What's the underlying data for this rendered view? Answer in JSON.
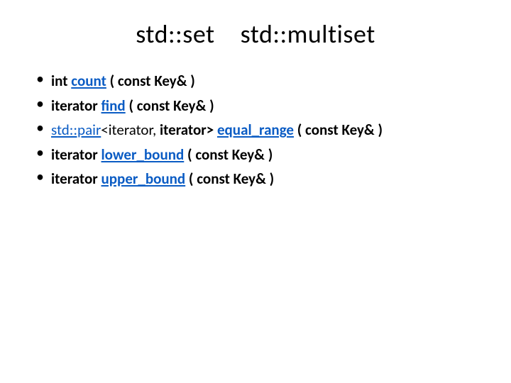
{
  "title": {
    "left": "std::set",
    "right": "std::multiset"
  },
  "items": [
    {
      "pre": "int ",
      "link": "count",
      "post": " ( const Key&  )"
    },
    {
      "pre": "iterator ",
      "link": "find",
      "post": " ( const Key& )"
    },
    {
      "pairlink": "std::pair",
      "template_open": "<iterator",
      "comma": ", ",
      "template_rest": "iterator> ",
      "link": "equal_range",
      "post": " ( const Key& )"
    },
    {
      "pre": "iterator ",
      "link": "lower_bound",
      "post": " ( const Key& )"
    },
    {
      "pre": "iterator ",
      "link": "upper_bound",
      "post": " ( const Key& )"
    }
  ]
}
